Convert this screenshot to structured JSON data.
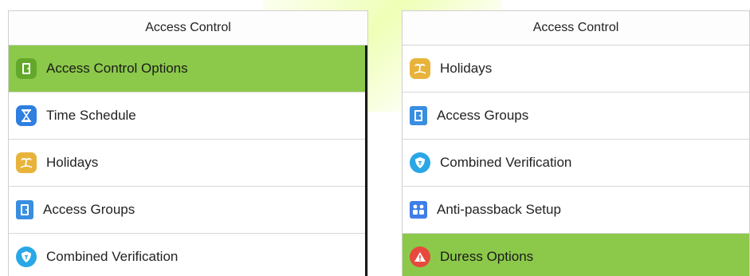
{
  "left_panel": {
    "title": "Access Control",
    "items": [
      {
        "label": "Access Control Options",
        "icon": "door-icon",
        "selected": true
      },
      {
        "label": "Time Schedule",
        "icon": "hourglass-icon",
        "selected": false
      },
      {
        "label": "Holidays",
        "icon": "palm-tree-icon",
        "selected": false
      },
      {
        "label": "Access Groups",
        "icon": "door-icon",
        "selected": false
      },
      {
        "label": "Combined Verification",
        "icon": "shield-icon",
        "selected": false
      }
    ]
  },
  "right_panel": {
    "title": "Access Control",
    "items": [
      {
        "label": "Holidays",
        "icon": "palm-tree-icon",
        "selected": false
      },
      {
        "label": "Access Groups",
        "icon": "door-icon",
        "selected": false
      },
      {
        "label": "Combined Verification",
        "icon": "shield-icon",
        "selected": false
      },
      {
        "label": "Anti-passback Setup",
        "icon": "people-icon",
        "selected": false
      },
      {
        "label": "Duress Options",
        "icon": "warning-icon",
        "selected": true
      }
    ]
  },
  "colors": {
    "selected": "#8cc94a",
    "door_green": "#63a82a",
    "door_blue": "#3a8ee0",
    "hourglass": "#2e7fe0",
    "holiday": "#e8b33a",
    "shield": "#2aa7e6",
    "people": "#3f7ee8",
    "warning": "#e8483d"
  }
}
